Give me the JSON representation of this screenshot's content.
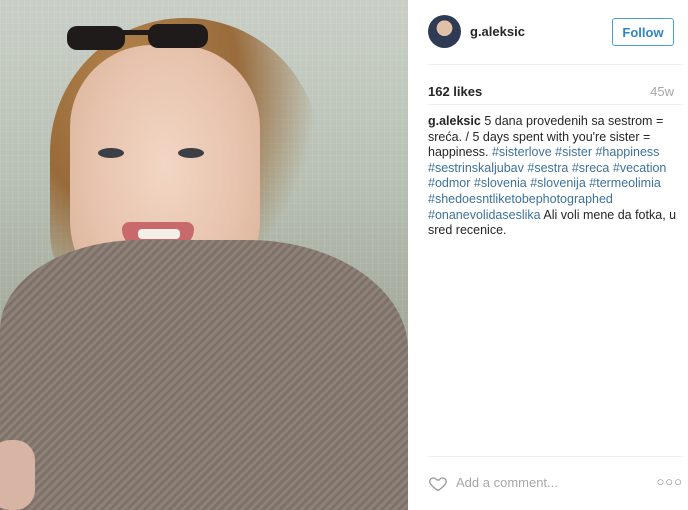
{
  "post": {
    "username": "g.aleksic",
    "follow_label": "Follow",
    "likes": "162 likes",
    "age": "45w",
    "caption_parts": [
      {
        "t": "5 dana provedenih sa sestrom = sreća. / 5 days spent with you're sister = happiness. ",
        "tag": false
      },
      {
        "t": "#sisterlove",
        "tag": true
      },
      {
        "t": " ",
        "tag": false
      },
      {
        "t": "#sister",
        "tag": true
      },
      {
        "t": " ",
        "tag": false
      },
      {
        "t": "#happiness",
        "tag": true
      },
      {
        "t": " ",
        "tag": false
      },
      {
        "t": "#sestrinskaljubav",
        "tag": true
      },
      {
        "t": " ",
        "tag": false
      },
      {
        "t": "#sestra",
        "tag": true
      },
      {
        "t": " ",
        "tag": false
      },
      {
        "t": "#sreca",
        "tag": true
      },
      {
        "t": " ",
        "tag": false
      },
      {
        "t": "#vecation",
        "tag": true
      },
      {
        "t": " ",
        "tag": false
      },
      {
        "t": "#odmor",
        "tag": true
      },
      {
        "t": " ",
        "tag": false
      },
      {
        "t": "#slovenia",
        "tag": true
      },
      {
        "t": " ",
        "tag": false
      },
      {
        "t": "#slovenija",
        "tag": true
      },
      {
        "t": " ",
        "tag": false
      },
      {
        "t": "#termeolimia",
        "tag": true
      },
      {
        "t": " ",
        "tag": false
      },
      {
        "t": "#shedoesntliketobephotographed",
        "tag": true
      },
      {
        "t": " ",
        "tag": false
      },
      {
        "t": "#onanevolidaseslika",
        "tag": true
      },
      {
        "t": " Ali voli mene da fotka, u sred recenice.",
        "tag": false
      }
    ],
    "comment_placeholder": "Add a comment...",
    "more_label": "○○○"
  },
  "colors": {
    "follow_blue": "#2c87c9",
    "hashtag": "#3f729b",
    "muted": "#a5a7aa"
  }
}
